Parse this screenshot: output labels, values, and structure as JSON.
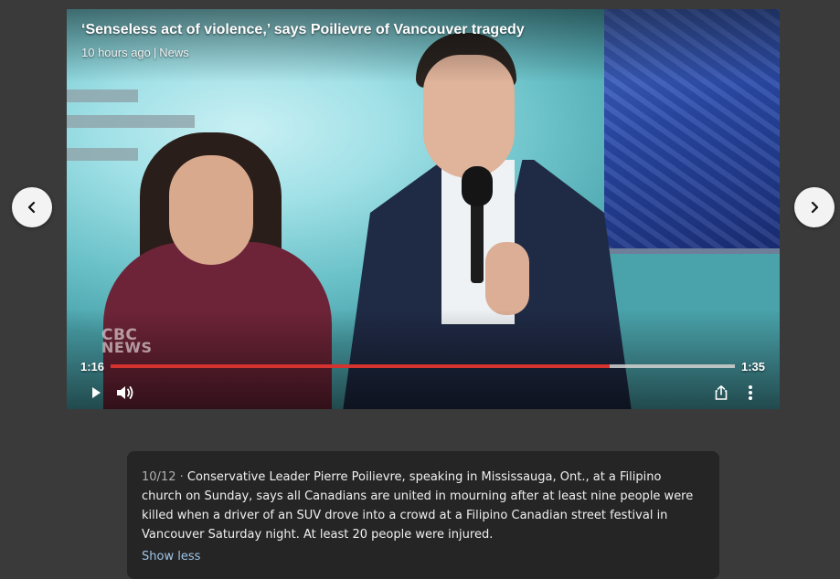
{
  "video": {
    "headline": "‘Senseless act of violence,’ says Poilievre of Vancouver tragedy",
    "age": "10 hours ago",
    "separator": "|",
    "category": "News",
    "watermark": {
      "line1": "CBC",
      "line2": "NEWS"
    },
    "current_time": "1:16",
    "total_time": "1:35",
    "progress_fraction": 0.8,
    "accent_color": "#d5332f"
  },
  "controls": {
    "play": "play-icon",
    "volume": "volume-icon",
    "share": "share-icon",
    "more": "more-vert-icon"
  },
  "navigation": {
    "prev": "chevron-left-icon",
    "next": "chevron-right-icon"
  },
  "caption": {
    "counter": "10/12 ·",
    "text": "Conservative Leader Pierre Poilievre, speaking in Mississauga, Ont., at a Filipino church on Sunday, says all Canadians are united in mourning after at least nine people were killed when a driver of an SUV drove into a crowd at a Filipino Canadian street festival in Vancouver Saturday night. At least 20 people were injured.",
    "toggle_label": "Show less"
  }
}
